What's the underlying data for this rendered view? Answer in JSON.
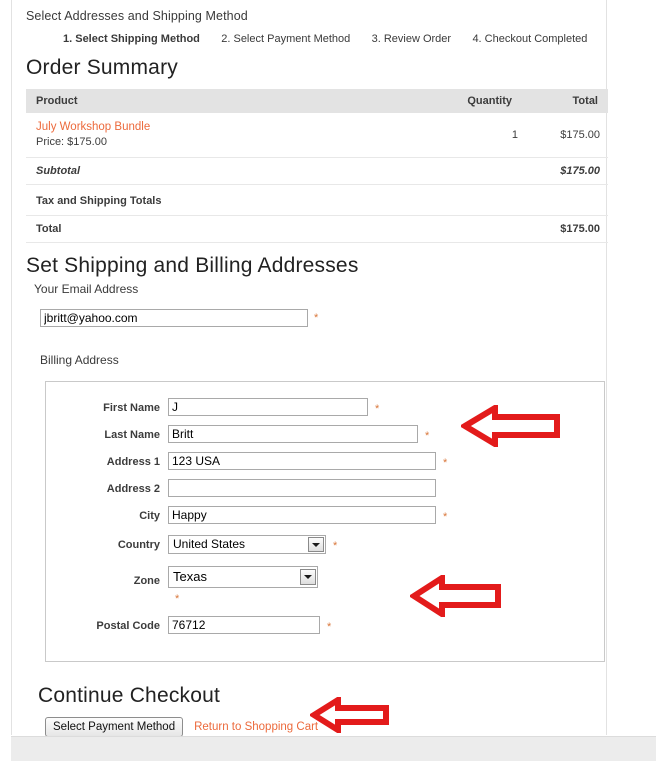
{
  "header": {
    "subtitle": "Select Addresses and Shipping Method",
    "steps": [
      {
        "label": "1. Select Shipping Method",
        "active": true
      },
      {
        "label": "2. Select Payment Method",
        "active": false
      },
      {
        "label": "3. Review Order",
        "active": false
      },
      {
        "label": "4. Checkout Completed",
        "active": false
      }
    ]
  },
  "order_summary": {
    "title": "Order Summary",
    "columns": {
      "product": "Product",
      "quantity": "Quantity",
      "total": "Total"
    },
    "items": [
      {
        "name": "July Workshop Bundle",
        "price_line": "Price: $175.00",
        "quantity": "1",
        "total": "$175.00"
      }
    ],
    "subtotal_label": "Subtotal",
    "subtotal_value": "$175.00",
    "tax_shipping_label": "Tax and Shipping Totals",
    "tax_shipping_value": "",
    "total_label": "Total",
    "total_value": "$175.00"
  },
  "addresses": {
    "title": "Set Shipping and Billing Addresses",
    "email_legend": "Your Email Address",
    "email_value": "jbritt@yahoo.com",
    "email_placeholder": "",
    "required_mark": "*",
    "billing_legend": "Billing Address",
    "fields": {
      "first_name": {
        "label": "First Name",
        "value": "J",
        "required": true
      },
      "last_name": {
        "label": "Last Name",
        "value": "Britt",
        "required": true
      },
      "address1": {
        "label": "Address 1",
        "value": "123 USA",
        "required": true
      },
      "address2": {
        "label": "Address 2",
        "value": "",
        "required": false
      },
      "city": {
        "label": "City",
        "value": "Happy",
        "required": true
      },
      "country": {
        "label": "Country",
        "value": "United States",
        "required": true
      },
      "zone": {
        "label": "Zone",
        "value": "Texas",
        "required": true
      },
      "postal_code": {
        "label": "Postal Code",
        "value": "76712",
        "required": true
      }
    }
  },
  "continue": {
    "title": "Continue Checkout",
    "submit_label": "Select Payment Method",
    "cart_link_label": "Return to Shopping Cart"
  },
  "annotations": {
    "arrow_color": "#e31b1b",
    "arrows": [
      {
        "name": "arrow-pointing-last-name"
      },
      {
        "name": "arrow-pointing-postal-code"
      },
      {
        "name": "arrow-pointing-select-payment-method"
      }
    ]
  },
  "colors": {
    "link": "#ec6a3c",
    "table_header_bg": "#e3e3e3",
    "required_mark": "#d9763a",
    "footer_bg": "#ececec"
  }
}
